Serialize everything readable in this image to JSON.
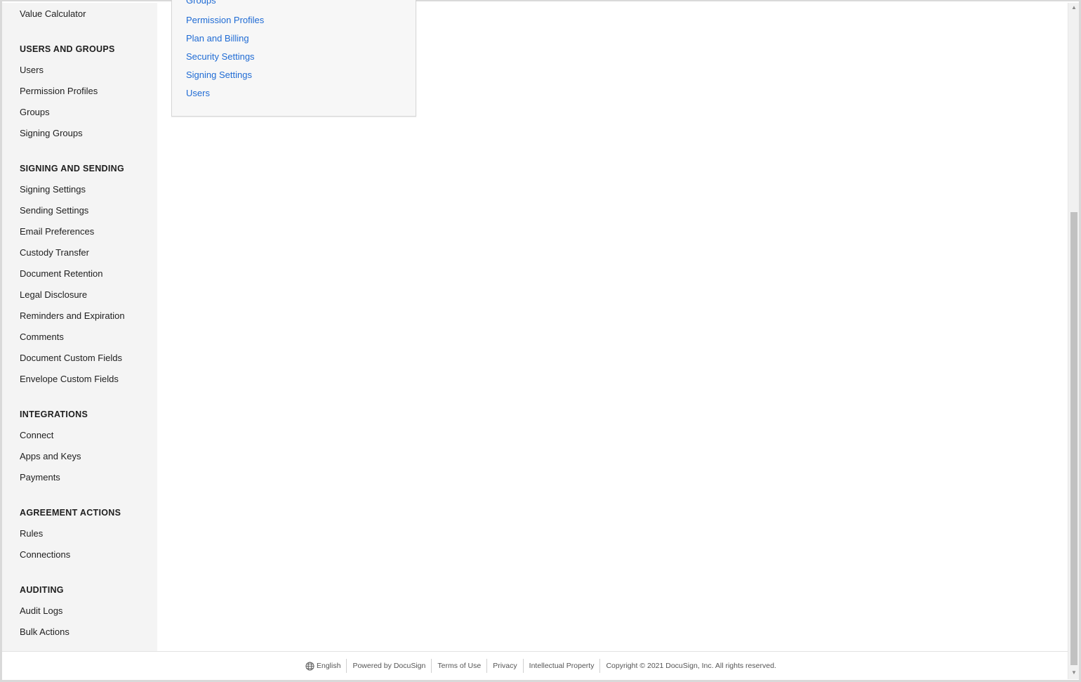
{
  "sidebar": {
    "top_item": "Value Calculator",
    "sections": [
      {
        "heading": "USERS AND GROUPS",
        "items": [
          "Users",
          "Permission Profiles",
          "Groups",
          "Signing Groups"
        ]
      },
      {
        "heading": "SIGNING AND SENDING",
        "items": [
          "Signing Settings",
          "Sending Settings",
          "Email Preferences",
          "Custody Transfer",
          "Document Retention",
          "Legal Disclosure",
          "Reminders and Expiration",
          "Comments",
          "Document Custom Fields",
          "Envelope Custom Fields"
        ]
      },
      {
        "heading": "INTEGRATIONS",
        "items": [
          "Connect",
          "Apps and Keys",
          "Payments"
        ]
      },
      {
        "heading": "AGREEMENT ACTIONS",
        "items": [
          "Rules",
          "Connections"
        ]
      },
      {
        "heading": "AUDITING",
        "items": [
          "Audit Logs",
          "Bulk Actions"
        ]
      }
    ]
  },
  "card": {
    "links": [
      "Groups",
      "Permission Profiles",
      "Plan and Billing",
      "Security Settings",
      "Signing Settings",
      "Users"
    ]
  },
  "footer": {
    "language": "English",
    "powered_by": "Powered by DocuSign",
    "terms": "Terms of Use",
    "privacy": "Privacy",
    "ip": "Intellectual Property",
    "copyright": "Copyright © 2021 DocuSign, Inc. All rights reserved."
  },
  "colors": {
    "link": "#1f6bd4",
    "sidebar_bg": "#f4f4f4",
    "card_bg": "#f7f7f7"
  }
}
